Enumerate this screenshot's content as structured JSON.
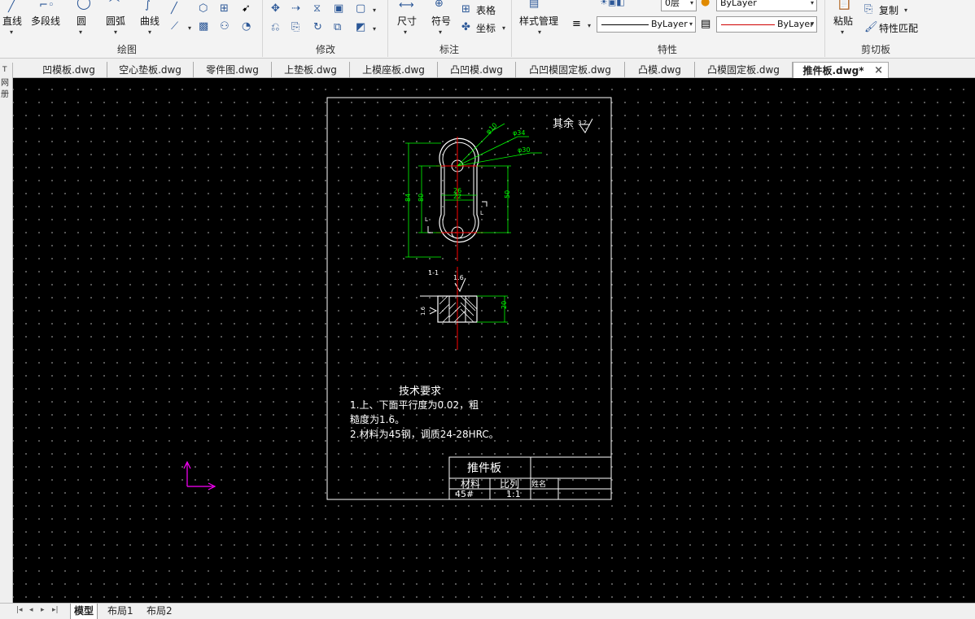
{
  "ribbon": {
    "draw": {
      "label": "绘图",
      "line": "直线",
      "polyline": "多段线",
      "circle": "圆",
      "arc": "圆弧",
      "curve": "曲线"
    },
    "modify": {
      "label": "修改"
    },
    "annotate": {
      "label": "标注",
      "dimension": "尺寸",
      "symbol": "符号",
      "table": "表格",
      "coordinate": "坐标"
    },
    "properties": {
      "label": "特性",
      "style_manager": "样式管理",
      "linetype": "ByLayer",
      "lineweight": "ByLayer",
      "layer_top": "ByLayer",
      "layer_name": "0层"
    },
    "clipboard": {
      "label": "剪切板",
      "paste": "粘贴",
      "copy": "复制",
      "match": "特性匹配"
    }
  },
  "doc_tabs": [
    "凹模板.dwg",
    "空心垫板.dwg",
    "零件图.dwg",
    "上垫板.dwg",
    "上模座板.dwg",
    "凸凹模.dwg",
    "凸凹模固定板.dwg",
    "凸模.dwg",
    "凸模固定板.dwg",
    "推件板.dwg*"
  ],
  "active_tab_close": "×",
  "left_strip": [
    "T",
    "网",
    "册"
  ],
  "drawing": {
    "roughness_note": "其余",
    "roughness_value": "3.2",
    "dims": {
      "d10": "φ10",
      "d34": "φ34",
      "d30": "φ30",
      "h84": "84",
      "h80": "80",
      "w26": "26",
      "w22": "22",
      "h50": "50",
      "sec_L": "L",
      "sec_L2": "L",
      "section_title": "1-1",
      "rough_top": "1.6",
      "rough_side": "1.6",
      "thick": "20"
    },
    "tech_title": "技术要求",
    "tech_lines": [
      "1.上、下面平行度为0.02，粗",
      "糙度为1.6。",
      "2.材料为45钢，调质24-28HRC。"
    ],
    "title_block": {
      "part_name": "推件板",
      "material_label": "材料",
      "scale_label": "比列",
      "name_label": "姓名",
      "material": "45#",
      "scale": "1:1"
    }
  },
  "layout_tabs": [
    "模型",
    "布局1",
    "布局2"
  ],
  "colors": {
    "canvas": "#000000",
    "frame": "#ffffff",
    "dimension": "#00ff00",
    "centerline": "#ff0000",
    "ucs": "#ff00ff"
  }
}
